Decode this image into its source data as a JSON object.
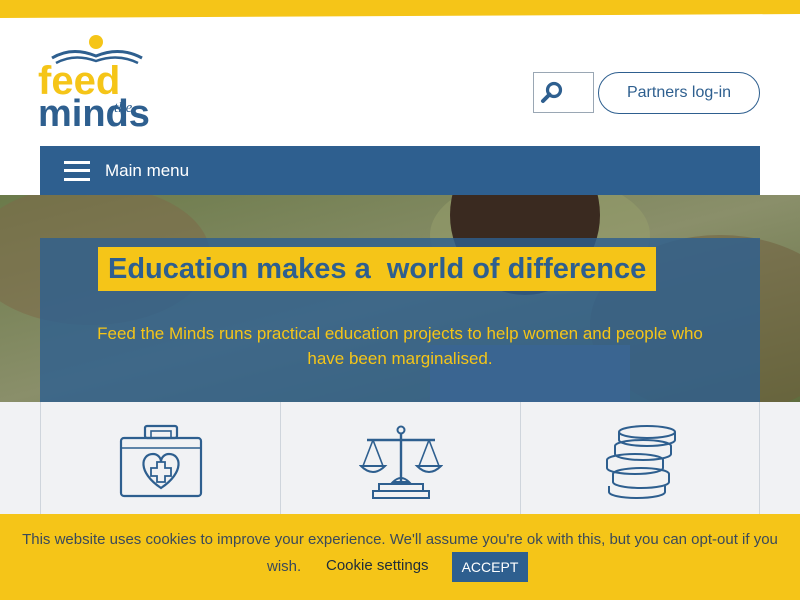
{
  "colors": {
    "brand_blue": "#2e5f8f",
    "brand_yellow": "#f5c518",
    "panel_gray": "#f1f2f4"
  },
  "logo": {
    "line1": "feed",
    "line2": "the",
    "line3": "minds"
  },
  "header": {
    "search": {
      "icon": "search-icon",
      "value": "",
      "placeholder": ""
    },
    "partners_label": "Partners log-in"
  },
  "nav": {
    "icon": "hamburger-icon",
    "label": "Main menu"
  },
  "hero": {
    "title": "Education makes a  world of difference",
    "subtitle": "Feed the Minds runs practical education projects to help women and people who have been marginalised."
  },
  "features": [
    {
      "icon": "medical-kit-heart-icon"
    },
    {
      "icon": "scales-of-justice-icon"
    },
    {
      "icon": "coin-stack-icon"
    }
  ],
  "cookie": {
    "message": "This website uses cookies to improve your experience. We'll assume you're ok with this, but you can opt-out if you",
    "message_end": "wish.",
    "settings_label": "Cookie settings",
    "accept_label": "ACCEPT"
  }
}
